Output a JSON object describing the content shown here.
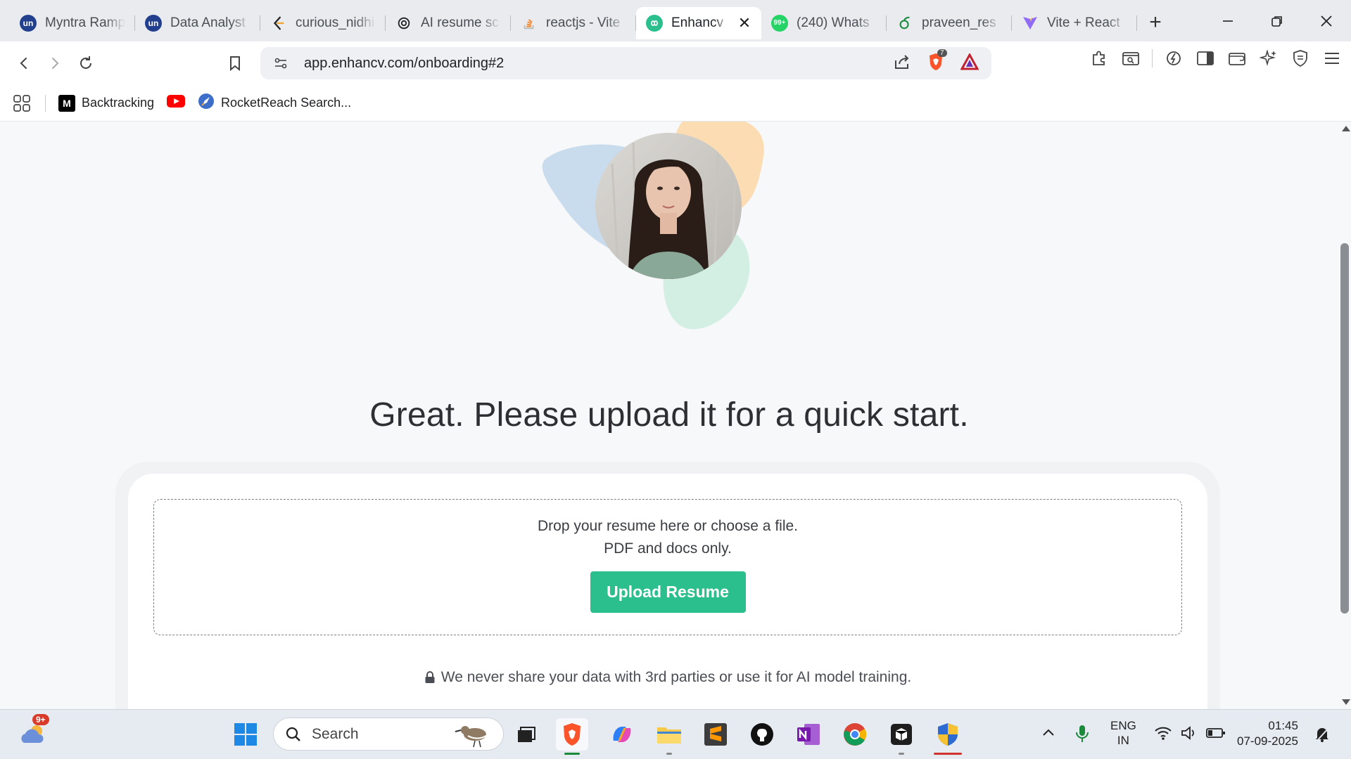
{
  "browser": {
    "tabs": [
      {
        "title": "Myntra Ramp",
        "icon": "unstop-icon"
      },
      {
        "title": "Data Analyst",
        "icon": "unstop-icon"
      },
      {
        "title": "curious_nidhi",
        "icon": "leetcode-icon"
      },
      {
        "title": "AI resume sc",
        "icon": "openai-icon"
      },
      {
        "title": "reactjs - Vite",
        "icon": "stackoverflow-icon"
      },
      {
        "title": "Enhancv",
        "icon": "enhancv-icon",
        "active": true
      },
      {
        "title": "(240) Whats",
        "icon": "whatsapp-icon"
      },
      {
        "title": "praveen_res",
        "icon": "overleaf-icon"
      },
      {
        "title": "Vite + React",
        "icon": "vite-icon"
      }
    ],
    "url": "app.enhancv.com/onboarding#2",
    "brave_badge_count": "7",
    "bookmarks": [
      {
        "label": "Backtracking",
        "icon": "medium-icon"
      },
      {
        "label": "",
        "icon": "youtube-icon"
      },
      {
        "label": "RocketReach Search...",
        "icon": "rocketreach-icon"
      }
    ]
  },
  "page": {
    "headline": "Great. Please upload it for a quick start.",
    "dropzone_line1": "Drop your resume here or choose a file.",
    "dropzone_line2": "PDF and docs only.",
    "upload_button": "Upload Resume",
    "privacy_note": "We never share your data with 3rd parties or use it for AI model training."
  },
  "taskbar": {
    "search_placeholder": "Search",
    "weather_badge": "9+",
    "language": "ENG",
    "region": "IN",
    "time": "01:45",
    "date": "07-09-2025"
  },
  "colors": {
    "accent_green": "#2bbf8e",
    "blob_blue": "#c9dcee",
    "blob_orange": "#fbdcb3",
    "blob_green": "#d3efe4"
  }
}
